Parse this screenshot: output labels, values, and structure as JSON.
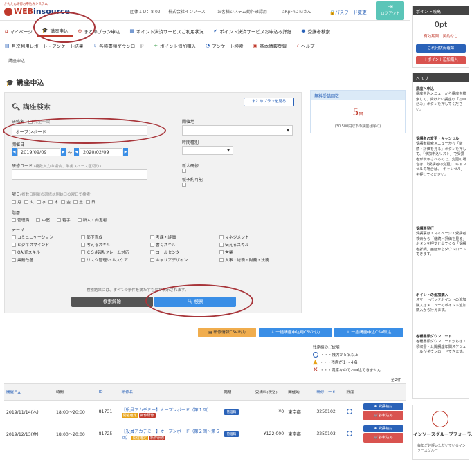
{
  "header": {
    "logo_sub": "かんたん研修お申込みシステム",
    "logo_web": "WEB",
    "logo_rest": "insource",
    "group_id": "団体ＩＤ：8-02",
    "company": "株式会社インソース",
    "dept": "お客様システム動作確認用",
    "user": "aKpFhDTuさん",
    "password_change": "パスワード変更",
    "logout": "ログアウト"
  },
  "nav_row1": [
    {
      "icon": "⌂",
      "label": "マイページ"
    },
    {
      "icon": "🎓",
      "label": "講座申込"
    },
    {
      "icon": "⊕",
      "label": "まとめプラン申込"
    },
    {
      "icon": "▦",
      "label": "ポイント決済サービスご利用状況"
    },
    {
      "icon": "✔",
      "label": "ポイント決済サービスお申込み詳細"
    },
    {
      "icon": "◉",
      "label": "受講者検索"
    }
  ],
  "nav_row2": [
    {
      "icon": "▤",
      "label": "月次利用レポート・アンケート結果"
    },
    {
      "icon": "⇩",
      "label": "各種書類ダウンロード"
    },
    {
      "icon": "+",
      "label": "ポイント追加購入"
    },
    {
      "icon": "◔",
      "label": "アンケート検索"
    },
    {
      "icon": "▣",
      "label": "基本情報登録"
    },
    {
      "icon": "?",
      "label": "ヘルプ"
    }
  ],
  "breadcrumb": "講座申込",
  "page_title": "講座申込",
  "search": {
    "title": "講座検索",
    "plan_button": "まとめプランを見る",
    "course_name_label": "研修名",
    "exact_match": "完全一致",
    "course_name_value": "オープンボード",
    "venue_label": "開催地",
    "period_label": "開催日",
    "date_from": "2019/09/09",
    "date_sep": "～",
    "date_to": "2020/02/09",
    "time_label": "時間種別",
    "code_label": "研修コード",
    "code_note": "(複数入力の場合、半角スペース区切り)",
    "new_label": "新人研修",
    "tentative_label": "仮予約可能",
    "weekday_label": "曜日",
    "weekday_note": "(複数日開催の研修は開始日の曜日で検索)",
    "weekdays": [
      "月",
      "火",
      "水",
      "木",
      "金",
      "土",
      "日"
    ],
    "level_label": "階層",
    "levels": [
      "管理職",
      "中堅",
      "若手",
      "新人・内定者"
    ],
    "theme_label": "テーマ",
    "themes": [
      [
        "コミュニケーション",
        "部下育成",
        "考課・評価",
        "マネジメント"
      ],
      [
        "ビジネスマインド",
        "考えるスキル",
        "書くスキル",
        "伝えるスキル"
      ],
      [
        "OA/ITスキル",
        "ＣＳ/接遇/クレーム対応",
        "コールセンター",
        "営業"
      ],
      [
        "業務改善",
        "リスク管理/ヘルスケア",
        "キャリアデザイン",
        "人事・総務・財務・法務"
      ]
    ],
    "result_note": "検索結果には、すべての条件を満たすものが表示されます。",
    "clear_button": "検索解除",
    "search_button": "検索"
  },
  "free_box": {
    "title": "無料受講回数",
    "count": "5",
    "unit": "回",
    "note": "(30,500円以下の講座は除く)"
  },
  "csv": {
    "btn1": "研修情報CSV出力",
    "btn2": "一括講座申込用CSV出力",
    "btn3": "一括講座申込CSV取込"
  },
  "legend": {
    "title": "残席欄のご説明",
    "r1": "・・・残席が５名以上",
    "r2": "・・・残席が１～４名",
    "r3": "・・・満席なのでお申込できません"
  },
  "total": "全2件",
  "table": {
    "headers": [
      "開催日▲",
      "時間",
      "ID",
      "研修名",
      "階層",
      "受講料(税込)",
      "開催地",
      "研修コード",
      "残席",
      ""
    ],
    "rows": [
      {
        "date": "2019/11/14(木)",
        "time": "18:00～20:00",
        "id": "81731",
        "name": "【役員アカデミー】オープンボード（第１回）",
        "badge1": "開催確定",
        "badge2": "新作研修",
        "level": "管理職",
        "fee": "¥0",
        "venue": "東京都",
        "code": "3250102",
        "btn_review": "受講検討",
        "btn_apply": "お申込み"
      },
      {
        "date": "2019/12/13(金)",
        "time": "18:00～20:00",
        "id": "81725",
        "name": "【役員アカデミー】オープンボード（第２回～第６回）",
        "badge1": "開催確定",
        "badge2": "新作研修",
        "level": "管理職",
        "fee": "¥122,000",
        "venue": "東京都",
        "code": "3250103",
        "btn_review": "受講検討",
        "btn_apply": "お申込み"
      }
    ]
  },
  "points": {
    "title": "ポイント残高",
    "value": "0pt",
    "expiry": "有効期限：契約なし",
    "status_button": "ご利用状況確認",
    "add_button": "＋ポイント追加購入"
  },
  "help": {
    "title": "ヘルプ",
    "s1_title": "講座へ申込",
    "s1_body": "講座申込メニューから講座を検索して、受けたい講座の「お申込み」ボタンを押してください。",
    "s2_title": "受講者の変更・キャンセル",
    "s2_body": "受講者検索メニューから「継続・評価を見る」ボタンを押して、「参加申込リスト」で受講者が表示されるので、変更の場合は、「受講者の変更」、キャンセルの場合は、「キャンセル」を押してください。",
    "s3_title": "受講票発行",
    "s3_body": "受講票は・マイページ・受講者検索から「継続・評価を見る」ボタンを押すと出てくる「受講者詳細」画面からダウンロードできます。",
    "s4_title": "ポイントの追加購入",
    "s4_body": "スマートパックポイントの追加購入はメニューのポイント追加購入から行えます。",
    "s5_title": "各種書類ダウンロード",
    "s5_body": "各種書類ダウンロードからは・領収書・公開講座年間スケジュールがダウンロードできます。"
  },
  "forum": {
    "title": "インソースグループフォーラム",
    "desc": "毎年ご好評いただいているインソースグルー"
  },
  "colors": {
    "brand_red": "#c0392b",
    "link_blue": "#2a62b8",
    "button_blue": "#3a8ee6",
    "logout_teal": "#5bc5b8",
    "csv_orange": "#f0ad4e",
    "annotation": "#a8353a"
  }
}
